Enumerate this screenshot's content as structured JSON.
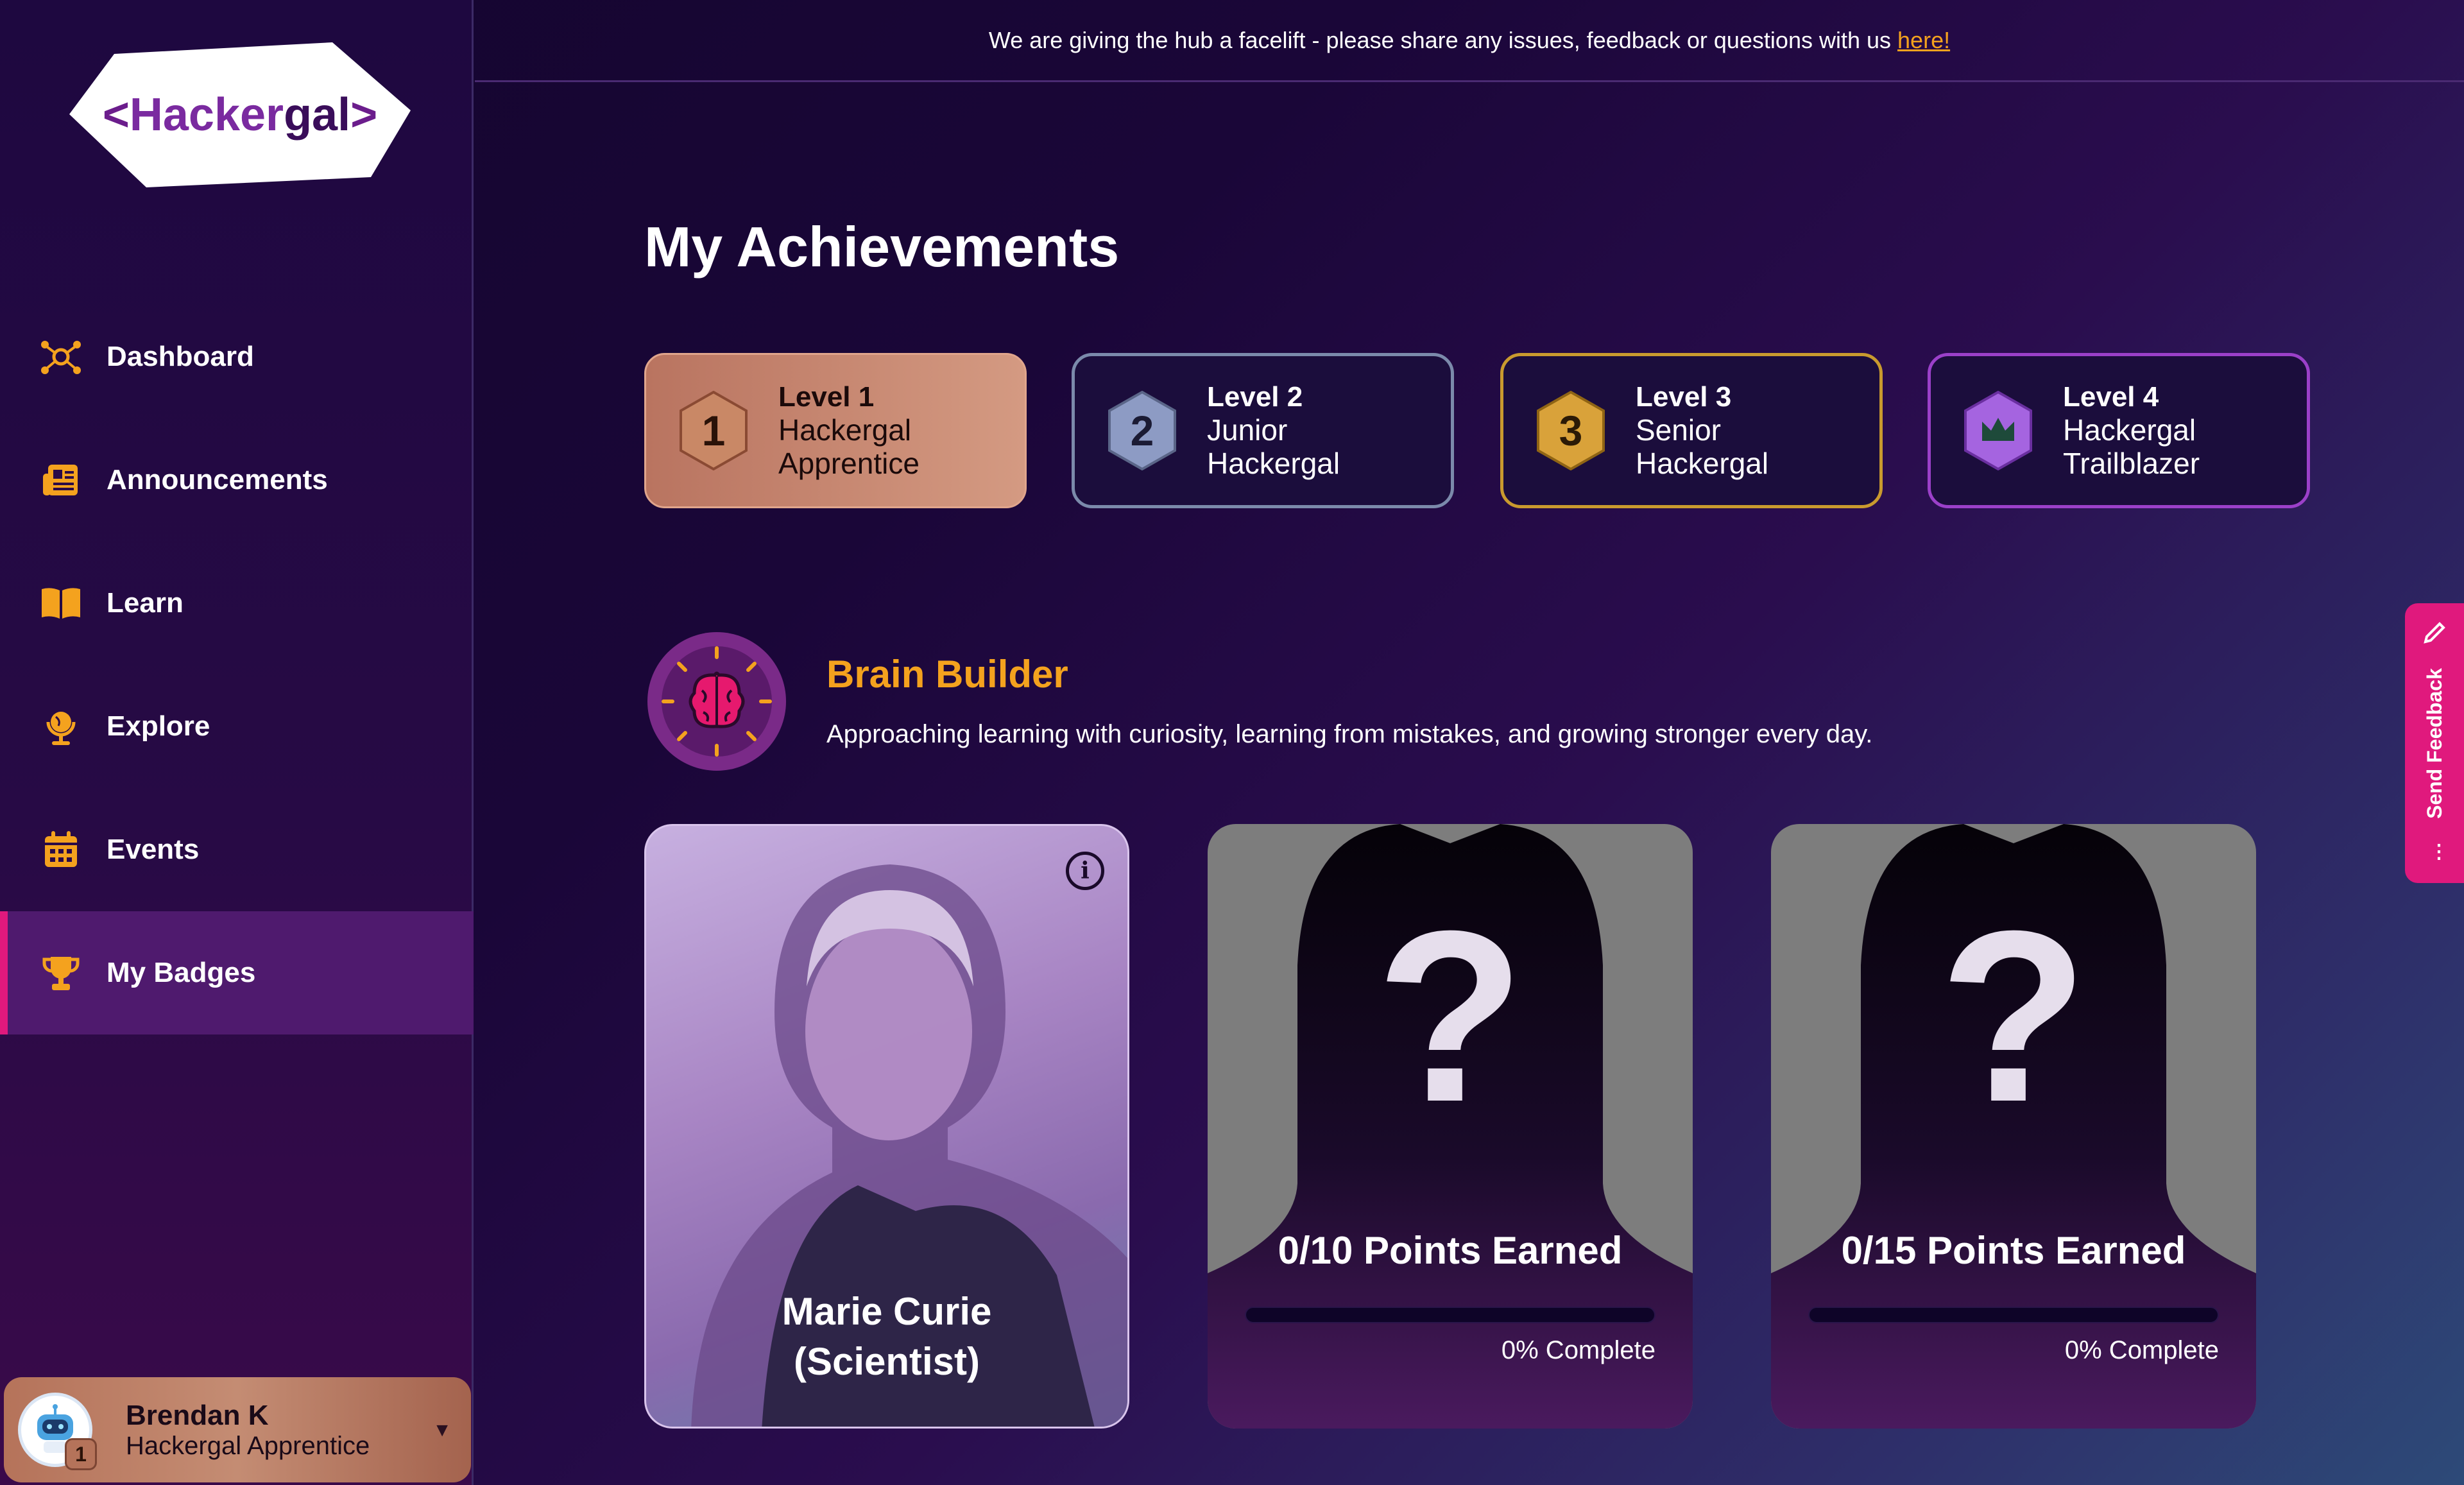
{
  "banner": {
    "text": "We are giving the hub a facelift - please share any issues, feedback or questions with us",
    "link": "here!"
  },
  "logo": {
    "prefix": "<",
    "part1": "Hacker",
    "part2": "gal",
    "suffix": ">"
  },
  "sidebar": {
    "items": [
      {
        "label": "Dashboard",
        "icon": "network-icon"
      },
      {
        "label": "Announcements",
        "icon": "newspaper-icon"
      },
      {
        "label": "Learn",
        "icon": "book-icon"
      },
      {
        "label": "Explore",
        "icon": "globe-icon"
      },
      {
        "label": "Events",
        "icon": "calendar-icon"
      },
      {
        "label": "My Badges",
        "icon": "trophy-icon",
        "active": true
      }
    ]
  },
  "user": {
    "name": "Brendan K",
    "role": "Hackergal Apprentice",
    "badge_level": "1"
  },
  "page": {
    "title": "My Achievements"
  },
  "levels": [
    {
      "num": "1",
      "title": "Level 1",
      "name1": "Hackergal",
      "name2": "Apprentice"
    },
    {
      "num": "2",
      "title": "Level 2",
      "name1": "Junior",
      "name2": "Hackergal"
    },
    {
      "num": "3",
      "title": "Level 3",
      "name1": "Senior",
      "name2": "Hackergal"
    },
    {
      "num": "",
      "title": "Level 4",
      "name1": "Hackergal",
      "name2": "Trailblazer"
    }
  ],
  "category": {
    "title": "Brain Builder",
    "description": "Approaching learning with curiosity, learning from mistakes, and growing stronger every day."
  },
  "cards": [
    {
      "name1": "Marie Curie",
      "name2": "(Scientist)",
      "info": "i"
    },
    {
      "points": "0/10 Points Earned",
      "progress": 0,
      "percent": "0% Complete",
      "mark": "?"
    },
    {
      "points": "0/15 Points Earned",
      "progress": 0,
      "percent": "0% Complete",
      "mark": "?"
    }
  ],
  "feedback": {
    "label": "Send Feedback"
  },
  "colors": {
    "accent": "#e0197d",
    "gold": "#f4a21e",
    "bronze": "#b97460"
  }
}
